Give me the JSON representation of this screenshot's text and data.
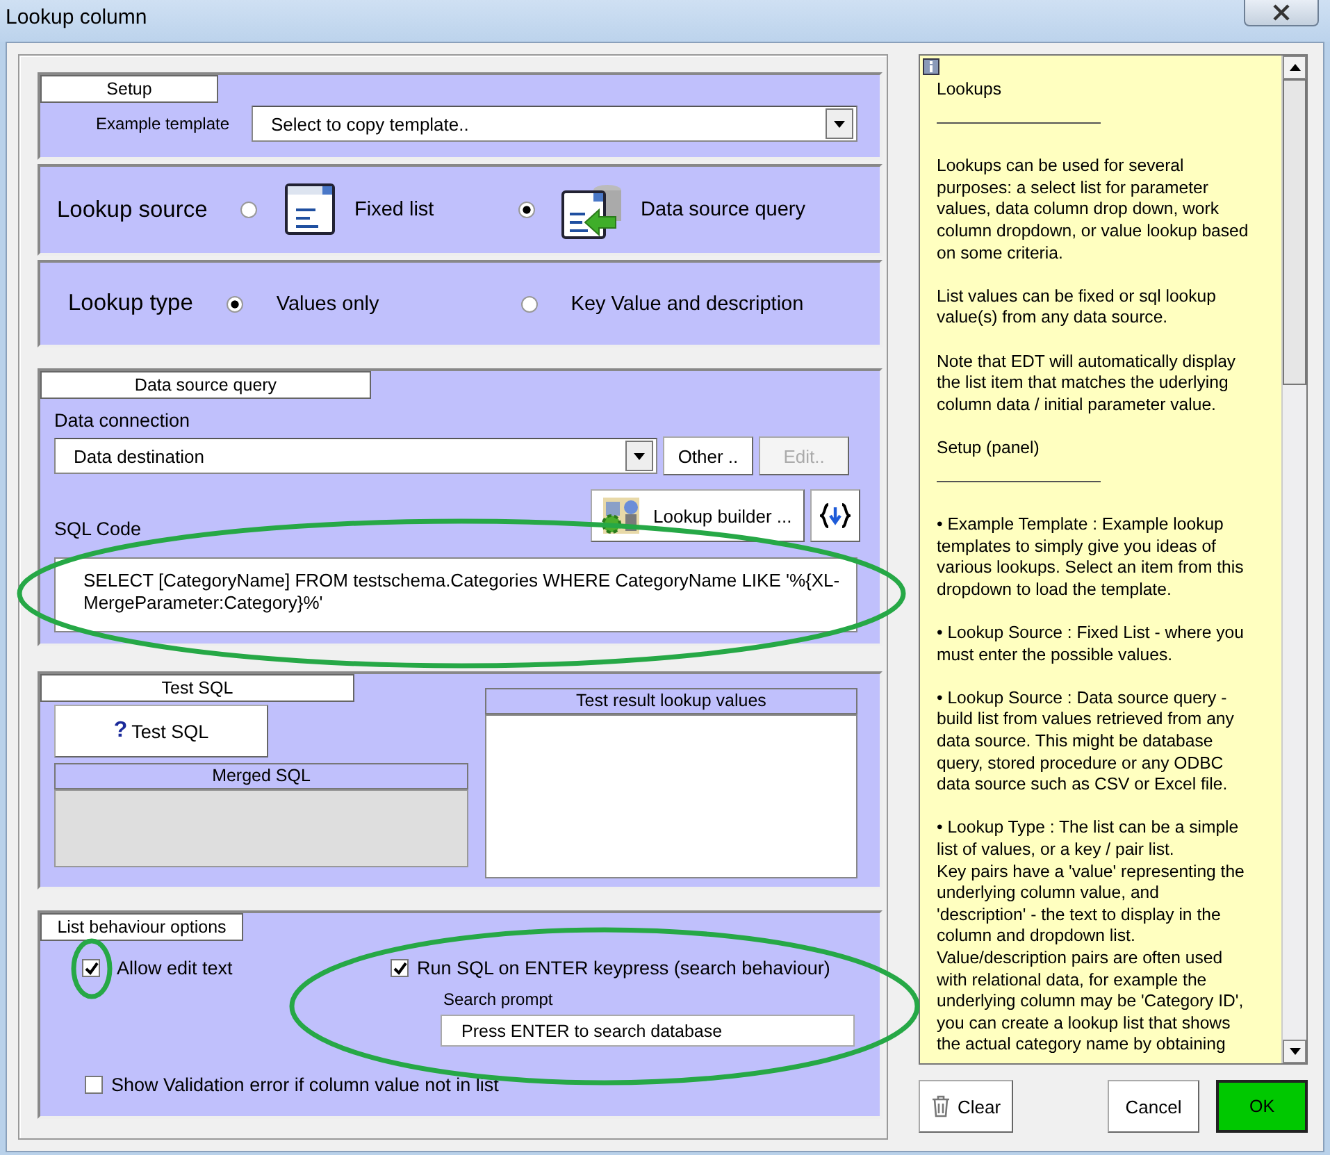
{
  "window": {
    "title": "Lookup column"
  },
  "setup": {
    "heading": "Setup",
    "template_label": "Example template",
    "template_value": "Select to copy template.."
  },
  "lookup_source": {
    "label": "Lookup source",
    "options": [
      {
        "label": "Fixed list",
        "selected": false,
        "kind": "list"
      },
      {
        "label": "Data source query",
        "selected": true,
        "kind": "database"
      }
    ]
  },
  "lookup_type": {
    "label": "Lookup type",
    "options": [
      {
        "label": "Values only",
        "selected": true
      },
      {
        "label": "Key Value and description",
        "selected": false
      }
    ]
  },
  "data_source_query": {
    "heading": "Data source query",
    "connection_label": "Data connection",
    "connection_value": "Data destination",
    "buttons": [
      {
        "label": "Other ..",
        "disabled": false
      },
      {
        "label": "Edit..",
        "disabled": true
      }
    ],
    "sql_label": "SQL Code",
    "builder_button": "Lookup builder ...",
    "sql_text": "SELECT [CategoryName] FROM testschema.Categories WHERE CategoryName LIKE '%{XL-MergeParameter:Category}%'"
  },
  "test_sql": {
    "heading": "Test SQL",
    "test_icon": "?",
    "test_button": "Test SQL",
    "merged_heading": "Merged SQL",
    "results_heading": "Test result lookup values"
  },
  "list_behaviour": {
    "heading": "List behaviour options",
    "options": [
      {
        "label": "Allow edit text",
        "checked": true
      },
      {
        "label": "Run SQL on ENTER keypress (search behaviour)",
        "checked": true
      },
      {
        "label": "Show Validation error if column value not in list",
        "checked": false
      }
    ],
    "search_prompt_label": "Search prompt",
    "search_prompt_value": "Press ENTER to search database"
  },
  "help": {
    "paragraphs": [
      {
        "kind": "text",
        "lines": [
          "Lookups"
        ]
      },
      {
        "kind": "rule"
      },
      {
        "kind": "text",
        "lines": [
          "Lookups can be used for several",
          "purposes:  a select list for parameter",
          "values,  data column drop down, work",
          "column dropdown, or value lookup based",
          "on some criteria."
        ]
      },
      {
        "kind": "text",
        "lines": [
          "List values can be fixed or sql lookup",
          "value(s) from any data source."
        ]
      },
      {
        "kind": "text",
        "lines": [
          "Note that EDT will automatically display",
          "the list item that matches the uderlying",
          "column data / initial parameter value."
        ]
      },
      {
        "kind": "text",
        "lines": [
          "Setup (panel)"
        ]
      },
      {
        "kind": "rule"
      },
      {
        "kind": "text",
        "lines": [
          "• Example Template : Example lookup",
          "templates to simply give you ideas of",
          "various lookups.  Select an item from this",
          "dropdown to load the template."
        ]
      },
      {
        "kind": "text",
        "lines": [
          "• Lookup Source : Fixed List - where you",
          "must enter the possible values."
        ]
      },
      {
        "kind": "text",
        "lines": [
          "• Lookup Source : Data source query -",
          "build list from values retrieved from any",
          "data source. This might be database",
          "query, stored procedure or any ODBC",
          "data source such as CSV or Excel file."
        ]
      },
      {
        "kind": "text",
        "lines": [
          "• Lookup Type : The list can be a simple",
          "list of values, or a key / pair list.",
          "Key pairs have a 'value' representing the",
          "underlying column value, and",
          "'description' - the text to display in the",
          "column and dropdown list.",
          "Value/description pairs are often used",
          "with relational data, for example the",
          "underlying column may be 'Category ID',",
          "you can create a lookup list that shows",
          "the actual category name by obtaining"
        ]
      }
    ]
  },
  "footer": {
    "clear": "Clear",
    "cancel": "Cancel",
    "ok": "OK"
  }
}
